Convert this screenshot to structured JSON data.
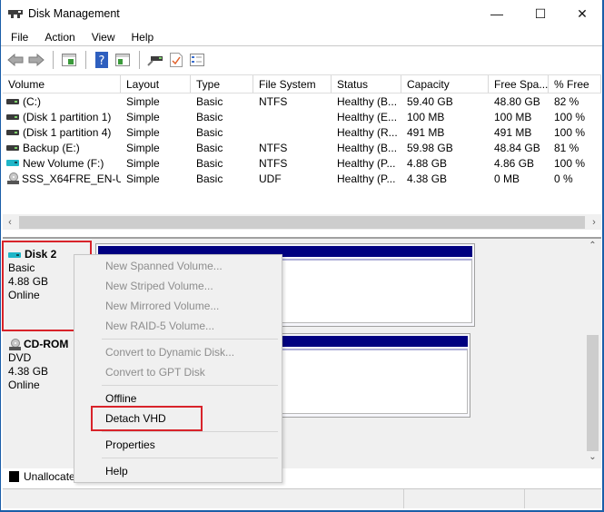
{
  "window": {
    "title": "Disk Management",
    "controls": {
      "minimize": "—",
      "maximize": "☐",
      "close": "✕"
    }
  },
  "menubar": [
    "File",
    "Action",
    "View",
    "Help"
  ],
  "toolbar": {
    "buttons": [
      "back-icon",
      "forward-icon",
      "show-hide-console-tree-icon",
      "help-icon",
      "show-hide-action-pane-icon",
      "connect-icon",
      "check-icon",
      "properties-list-icon"
    ]
  },
  "volume_list": {
    "columns": [
      "Volume",
      "Layout",
      "Type",
      "File System",
      "Status",
      "Capacity",
      "Free Spa...",
      "% Free"
    ],
    "rows": [
      {
        "icon": "disk",
        "volume": "(C:)",
        "layout": "Simple",
        "type": "Basic",
        "fs": "NTFS",
        "status": "Healthy (B...",
        "capacity": "59.40 GB",
        "free": "48.80 GB",
        "pct": "82 %"
      },
      {
        "icon": "disk",
        "volume": "(Disk 1 partition 1)",
        "layout": "Simple",
        "type": "Basic",
        "fs": "",
        "status": "Healthy (E...",
        "capacity": "100 MB",
        "free": "100 MB",
        "pct": "100 %"
      },
      {
        "icon": "disk",
        "volume": "(Disk 1 partition 4)",
        "layout": "Simple",
        "type": "Basic",
        "fs": "",
        "status": "Healthy (R...",
        "capacity": "491 MB",
        "free": "491 MB",
        "pct": "100 %"
      },
      {
        "icon": "disk",
        "volume": "Backup (E:)",
        "layout": "Simple",
        "type": "Basic",
        "fs": "NTFS",
        "status": "Healthy (B...",
        "capacity": "59.98 GB",
        "free": "48.84 GB",
        "pct": "81 %"
      },
      {
        "icon": "vhd",
        "volume": "New Volume (F:)",
        "layout": "Simple",
        "type": "Basic",
        "fs": "NTFS",
        "status": "Healthy (P...",
        "capacity": "4.88 GB",
        "free": "4.86 GB",
        "pct": "100 %"
      },
      {
        "icon": "cd",
        "volume": "SSS_X64FRE_EN-U...",
        "layout": "Simple",
        "type": "Basic",
        "fs": "UDF",
        "status": "Healthy (P...",
        "capacity": "4.38 GB",
        "free": "0 MB",
        "pct": "0 %"
      }
    ]
  },
  "disks": [
    {
      "name": "Disk 2",
      "type": "Basic",
      "size": "4.88 GB",
      "state": "Online"
    },
    {
      "name": "CD-ROM",
      "type": "DVD",
      "size": "4.38 GB",
      "state": "Online"
    }
  ],
  "legend": {
    "unallocated": "Unallocate"
  },
  "context_menu": {
    "items": [
      {
        "label": "New Spanned Volume...",
        "enabled": false
      },
      {
        "label": "New Striped Volume...",
        "enabled": false
      },
      {
        "label": "New Mirrored Volume...",
        "enabled": false
      },
      {
        "label": "New RAID-5 Volume...",
        "enabled": false
      },
      {
        "label": "Convert to Dynamic Disk...",
        "enabled": false
      },
      {
        "label": "Convert to GPT Disk",
        "enabled": false
      },
      {
        "label": "Offline",
        "enabled": true
      },
      {
        "label": "Detach VHD",
        "enabled": true,
        "highlighted": true
      },
      {
        "label": "Properties",
        "enabled": true
      },
      {
        "label": "Help",
        "enabled": true
      }
    ]
  },
  "colors": {
    "highlight_box": "#d8232a",
    "partition_bar": "#000080",
    "window_border": "#1a5ea8"
  }
}
